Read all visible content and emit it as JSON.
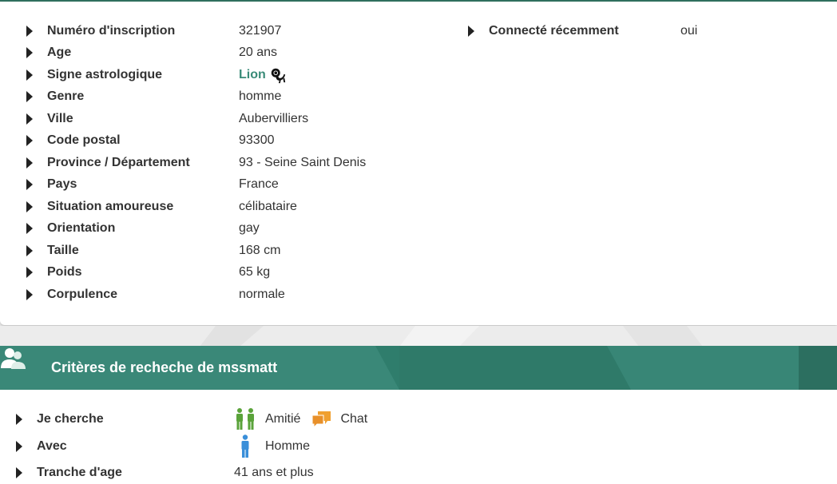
{
  "profile": {
    "rows": [
      {
        "label": "Numéro d'inscription",
        "value": "321907"
      },
      {
        "label": "Age",
        "value": "20 ans"
      },
      {
        "label": "Signe astrologique",
        "value": "Lion"
      },
      {
        "label": "Genre",
        "value": "homme"
      },
      {
        "label": "Ville",
        "value": "Aubervilliers"
      },
      {
        "label": "Code postal",
        "value": "93300"
      },
      {
        "label": "Province / Département",
        "value": "93 - Seine Saint Denis"
      },
      {
        "label": "Pays",
        "value": "France"
      },
      {
        "label": "Situation amoureuse",
        "value": "célibataire"
      },
      {
        "label": "Orientation",
        "value": "gay"
      },
      {
        "label": "Taille",
        "value": "168 cm"
      },
      {
        "label": "Poids",
        "value": "65 kg"
      },
      {
        "label": "Corpulence",
        "value": "normale"
      }
    ],
    "right_row": {
      "label": "Connecté récemment",
      "value": "oui"
    },
    "sign_icon": "lion-icon"
  },
  "criteria": {
    "title": "Critères de recheche de mssmatt",
    "rows": [
      {
        "label": "Je cherche",
        "items": [
          "Amitié",
          "Chat"
        ]
      },
      {
        "label": "Avec",
        "items": [
          "Homme"
        ]
      },
      {
        "label": "Tranche d'age",
        "value": "41 ans et plus"
      }
    ]
  },
  "colors": {
    "accent": "#2f7d6c",
    "sign": "#3a8b78",
    "friend_icon": "#5aa33a",
    "chat_icon": "#f0a030",
    "man_icon": "#3a8fd9"
  }
}
